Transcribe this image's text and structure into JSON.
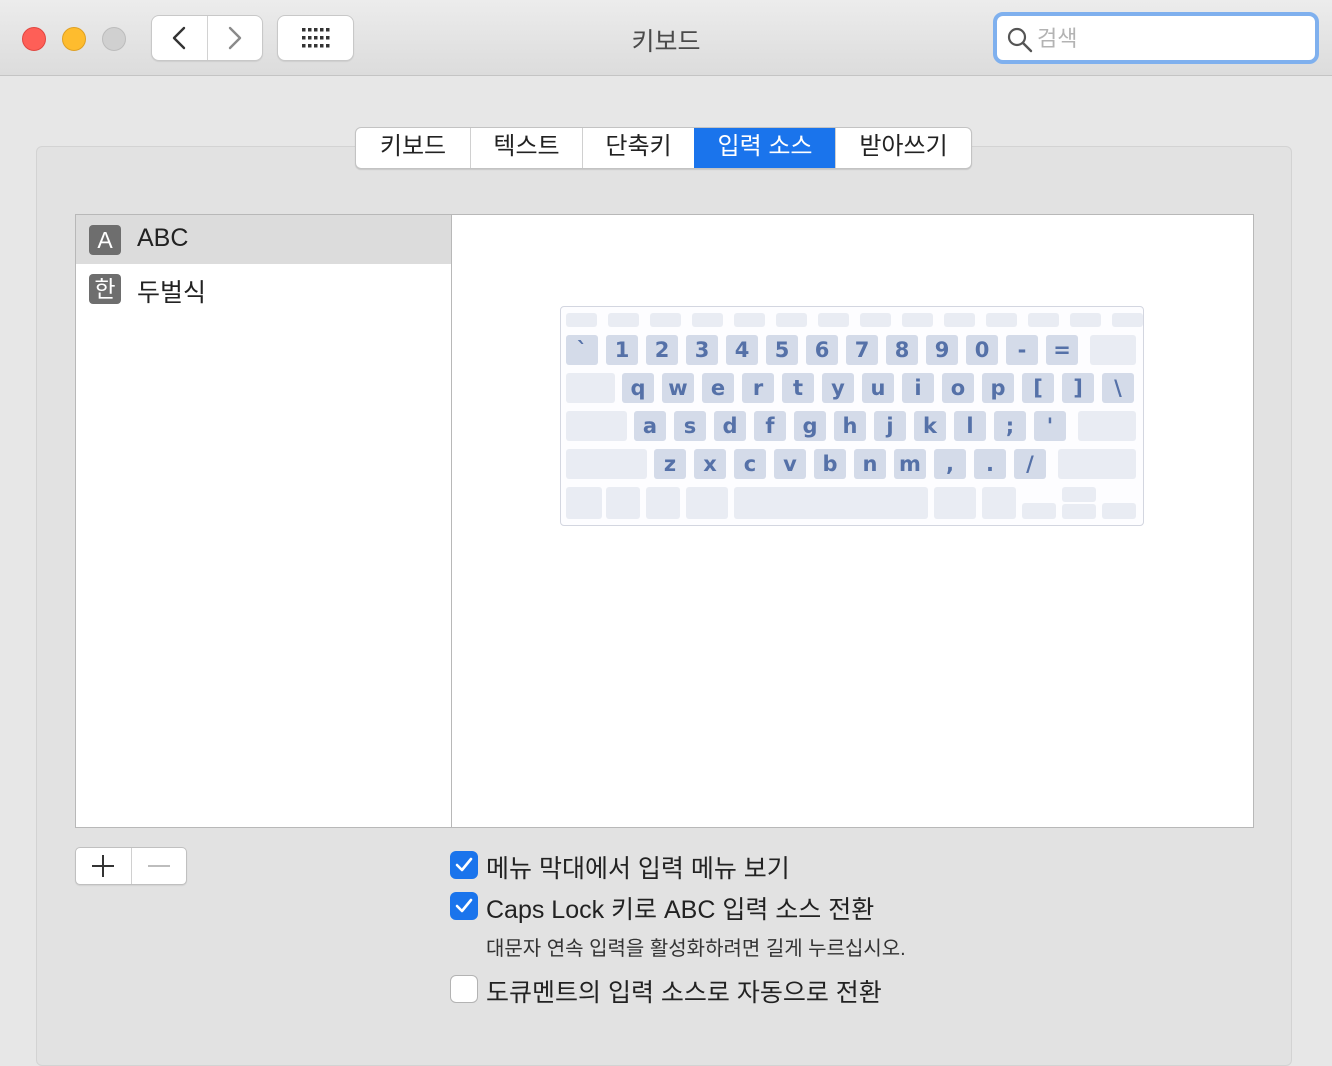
{
  "window": {
    "title": "키보드",
    "search_placeholder": "검색"
  },
  "tabs": [
    {
      "label": "키보드",
      "active": false
    },
    {
      "label": "텍스트",
      "active": false
    },
    {
      "label": "단축키",
      "active": false
    },
    {
      "label": "입력 소스",
      "active": true
    },
    {
      "label": "받아쓰기",
      "active": false
    }
  ],
  "input_sources": [
    {
      "icon_text": "A",
      "label": "ABC",
      "selected": true
    },
    {
      "icon_text": "한",
      "label": "두벌식",
      "selected": false
    }
  ],
  "keyboard_preview": {
    "rows": [
      [
        "`",
        "1",
        "2",
        "3",
        "4",
        "5",
        "6",
        "7",
        "8",
        "9",
        "0",
        "-",
        "="
      ],
      [
        "q",
        "w",
        "e",
        "r",
        "t",
        "y",
        "u",
        "i",
        "o",
        "p",
        "[",
        "]",
        "\\"
      ],
      [
        "a",
        "s",
        "d",
        "f",
        "g",
        "h",
        "j",
        "k",
        "l",
        ";",
        "'"
      ],
      [
        "z",
        "x",
        "c",
        "v",
        "b",
        "n",
        "m",
        ",",
        ".",
        "/"
      ]
    ]
  },
  "options": {
    "show_menu": {
      "label": "메뉴 막대에서 입력 메뉴 보기",
      "checked": true
    },
    "caps_lock": {
      "label": "Caps Lock 키로 ABC 입력 소스 전환",
      "checked": true
    },
    "caps_lock_hint": "대문자 연속 입력을 활성화하려면 길게 누르십시오.",
    "auto_switch": {
      "label": "도큐멘트의 입력 소스로 자동으로 전환",
      "checked": false
    }
  },
  "colors": {
    "accent": "#1a74ec",
    "close": "#fe5f57",
    "minimize": "#febc2e",
    "key_label": "#5571a8"
  }
}
